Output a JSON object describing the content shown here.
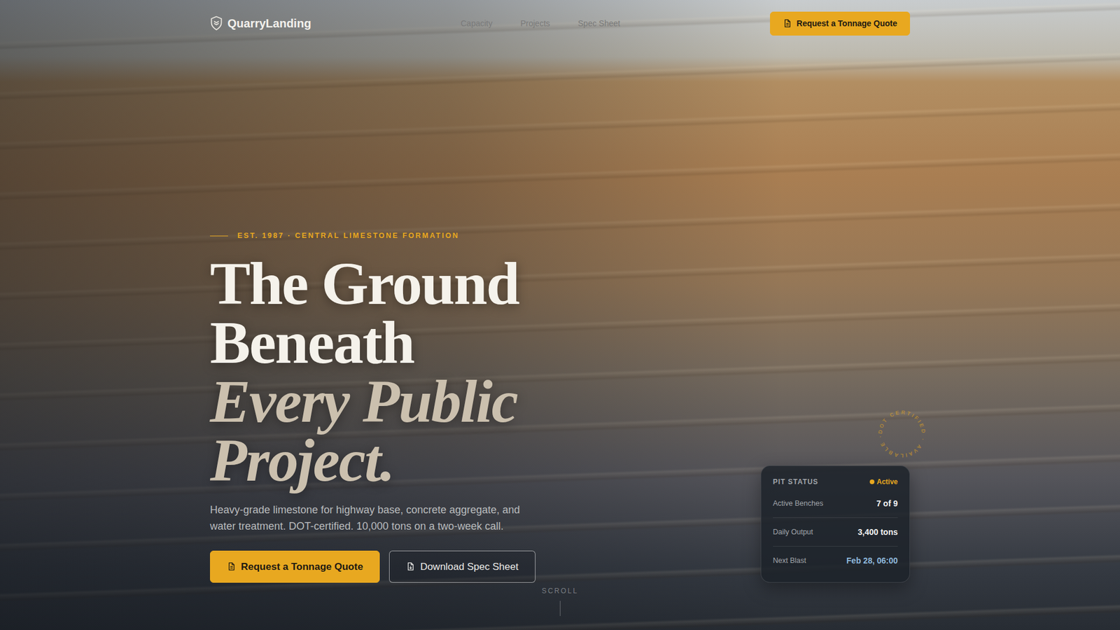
{
  "brand": {
    "name": "QuarryLanding"
  },
  "nav": {
    "links": [
      "Capacity",
      "Projects",
      "Spec Sheet"
    ],
    "cta": "Request a Tonnage Quote"
  },
  "hero": {
    "eyebrow": "EST. 1987 · CENTRAL LIMESTONE FORMATION",
    "headline": [
      {
        "text": "The Ground",
        "kind": "roman"
      },
      {
        "text": "Beneath",
        "kind": "roman"
      },
      {
        "text": "Every Public",
        "kind": "italic"
      },
      {
        "text": "Project.",
        "kind": "italic"
      }
    ],
    "lede": "Heavy-grade limestone for highway base, concrete aggregate, and water treatment. DOT-certified. 10,000 tons on a two-week call.",
    "buttons": [
      {
        "label": "Request a Tonnage Quote",
        "kind": "primary"
      },
      {
        "label": "Download Spec Sheet",
        "kind": "outline"
      }
    ],
    "scroll": "SCROLL"
  },
  "status": {
    "title": "PIT STATUS",
    "state": "Active",
    "color": "#e8a820",
    "seal": "DOT CERTIFIED · AVAILABLE · ",
    "rows": [
      {
        "label": "Active Benches",
        "value": "7 of 9",
        "kind": "plain"
      },
      {
        "label": "Daily Output",
        "value": "3,400 tons",
        "kind": "plain"
      },
      {
        "label": "Next Blast",
        "value": "Feb 28, 06:00",
        "kind": "accent"
      }
    ]
  }
}
